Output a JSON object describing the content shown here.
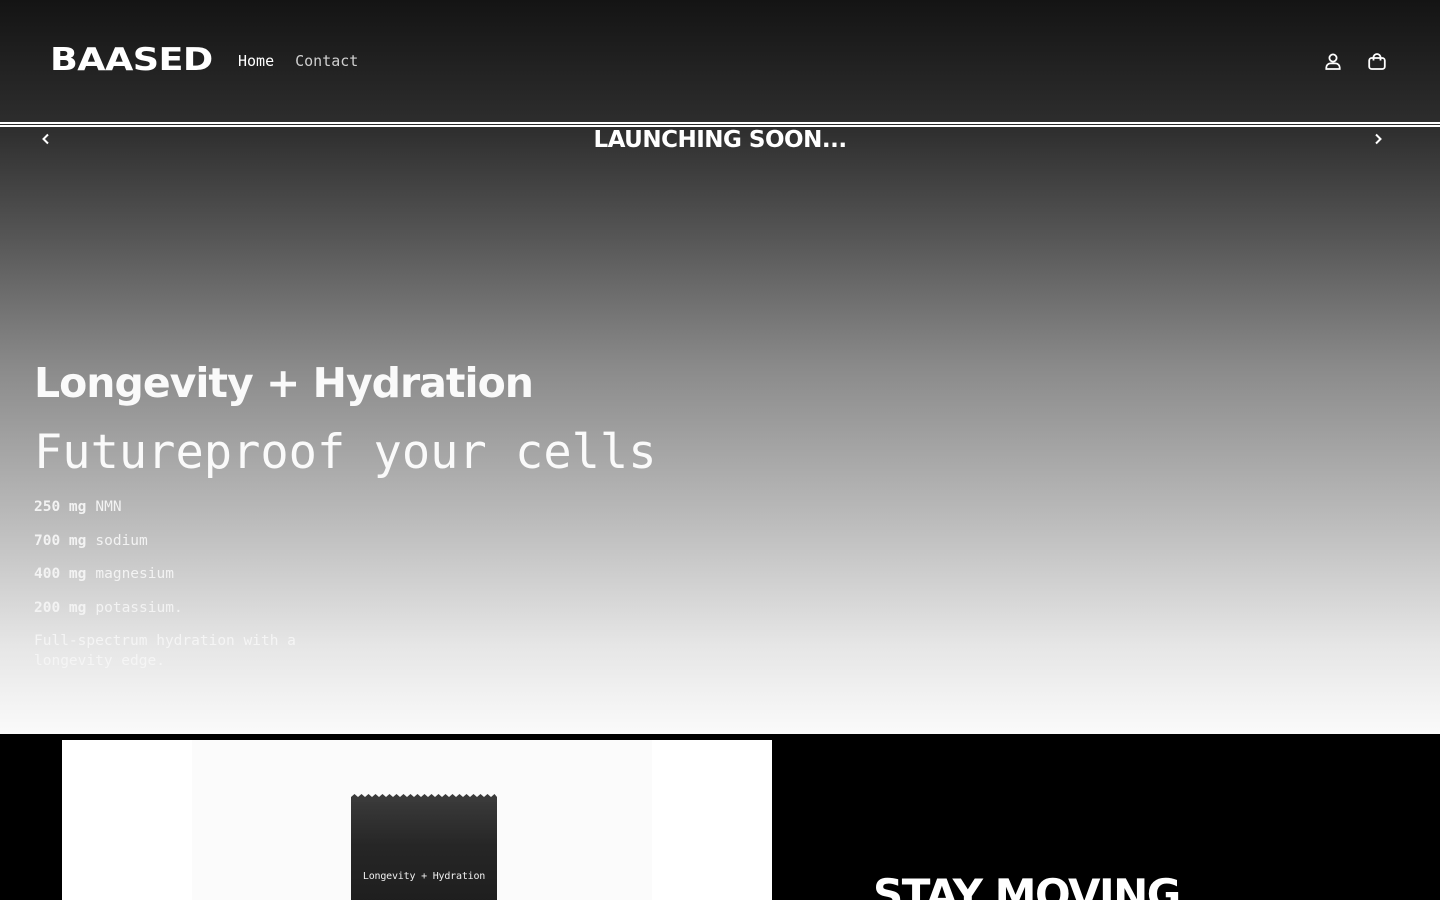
{
  "header": {
    "logo": "BAASED",
    "nav": [
      {
        "label": "Home",
        "active": true
      },
      {
        "label": "Contact",
        "active": false
      }
    ],
    "icons": [
      "account-icon",
      "cart-icon"
    ]
  },
  "announcement": {
    "text": "LAUNCHING SOON..."
  },
  "hero": {
    "title": "Longevity + Hydration",
    "subtitle": "Futureproof your cells",
    "specs": [
      {
        "amount": "250 mg",
        "name": "NMN"
      },
      {
        "amount": "700 mg",
        "name": "sodium"
      },
      {
        "amount": "400 mg",
        "name": "magnesium"
      },
      {
        "amount": "200 mg",
        "name": "potassium."
      }
    ],
    "description": "Full-spectrum hydration with a longevity edge."
  },
  "product": {
    "pouch_label": "Longevity + Hydration"
  },
  "section": {
    "heading": "STAY MOVING"
  },
  "colors": {
    "background_dark": "#141414",
    "text": "#ffffff"
  }
}
